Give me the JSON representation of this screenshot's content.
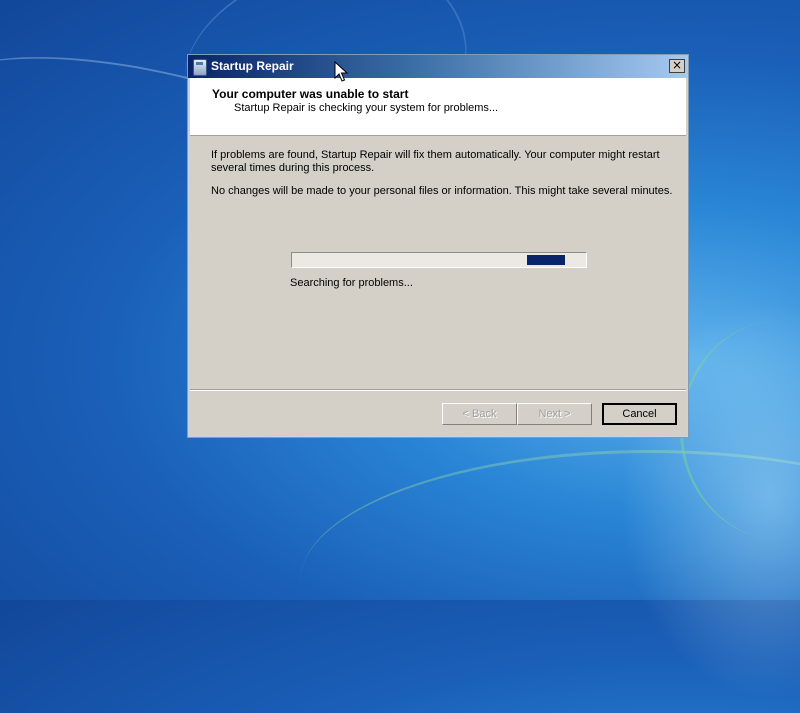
{
  "window": {
    "title": "Startup Repair",
    "close_glyph": "×"
  },
  "header": {
    "title": "Your computer was unable to start",
    "subtitle": "Startup Repair is checking your system for problems..."
  },
  "body": {
    "paragraph1": "If problems are found, Startup Repair will fix them automatically. Your computer might restart several times during this process.",
    "paragraph2": "No changes will be made to your personal files or information. This might take several minutes.",
    "status": "Searching for problems..."
  },
  "progress": {
    "chunk_start": 0.8,
    "chunk_end": 0.93,
    "color": "#0a246a"
  },
  "buttons": {
    "back": "< Back",
    "next": "Next >",
    "cancel": "Cancel"
  },
  "icons": {
    "app": "startup-repair-icon",
    "close": "close-icon",
    "cursor": "mouse-pointer-icon"
  },
  "colors": {
    "desktop": "#1a5fb8",
    "dialog_face": "#d4d0c8",
    "titlebar_start": "#0a246a",
    "titlebar_end": "#a6caf0"
  }
}
